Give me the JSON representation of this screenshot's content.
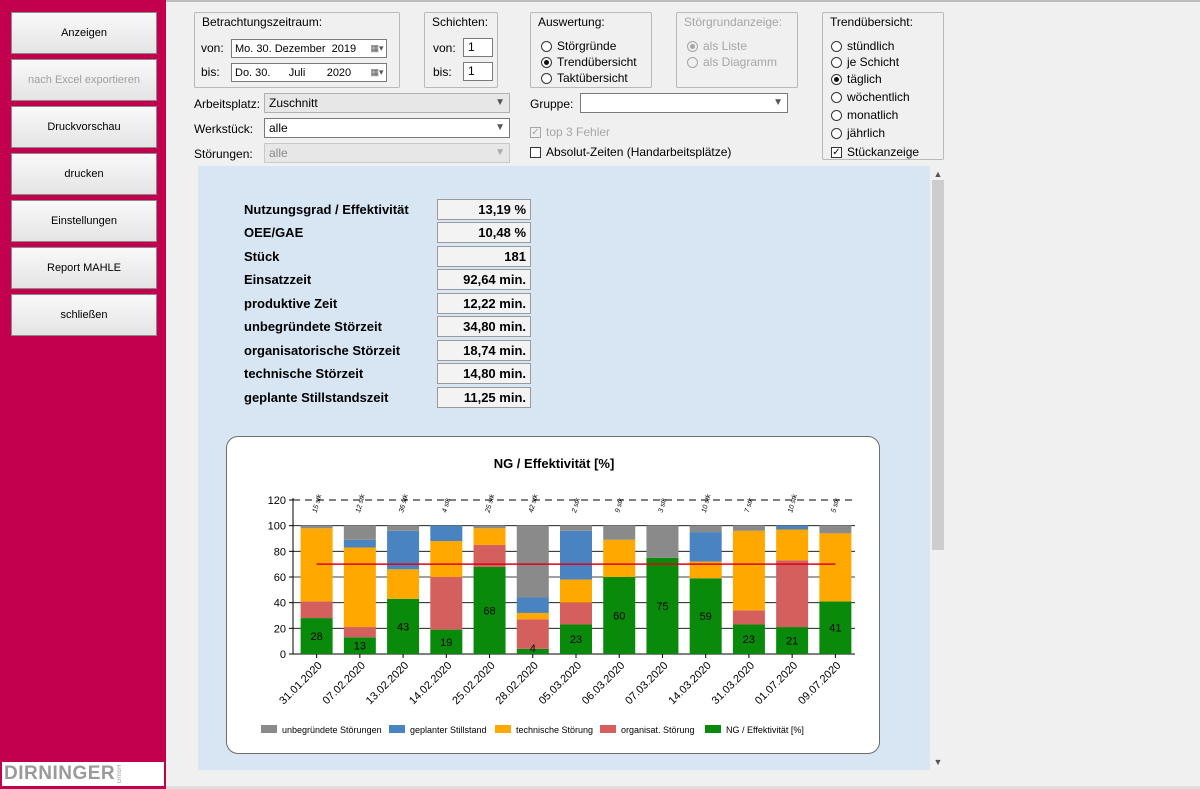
{
  "sidebar": {
    "buttons": [
      {
        "label": "Anzeigen",
        "enabled": true
      },
      {
        "label": "nach Excel exportieren",
        "enabled": false
      },
      {
        "label": "Druckvorschau",
        "enabled": true
      },
      {
        "label": "drucken",
        "enabled": true
      },
      {
        "label": "Einstellungen",
        "enabled": true
      },
      {
        "label": "Report MAHLE",
        "enabled": true
      },
      {
        "label": "schließen",
        "enabled": true
      }
    ],
    "logo": "DIRNINGER",
    "logo_tm": "GmbH",
    "accent_color": "#c2004e"
  },
  "zeitraum": {
    "title": "Betrachtungszeitraum:",
    "von_label": "von:",
    "von_value": "Mo. 30. Dezember  2019",
    "bis_label": "bis:",
    "bis_value": "Do. 30.      Juli       2020"
  },
  "schichten": {
    "title": "Schichten:",
    "von_label": "von:",
    "von_value": "1",
    "bis_label": "bis:",
    "bis_value": "1"
  },
  "auswertung": {
    "title": "Auswertung:",
    "options": [
      "Störgründe",
      "Trendübersicht",
      "Taktübersicht"
    ],
    "selected": "Trendübersicht"
  },
  "stoergrundanzeige": {
    "title": "Störgrundanzeige:",
    "options": [
      "als Liste",
      "als Diagramm"
    ],
    "selected": "als Liste"
  },
  "trenduebersicht": {
    "title": "Trendübersicht:",
    "options": [
      "stündlich",
      "je Schicht",
      "täglich",
      "wöchentlich",
      "monatlich",
      "jährlich"
    ],
    "selected": "täglich",
    "stueckanzeige_label": "Stückanzeige",
    "stueckanzeige_checked": true
  },
  "filters": {
    "arbeitsplatz_label": "Arbeitsplatz:",
    "arbeitsplatz_value": "Zuschnitt",
    "werkstueck_label": "Werkstück:",
    "werkstueck_value": "alle",
    "stoerungen_label": "Störungen:",
    "stoerungen_value": "alle",
    "gruppe_label": "Gruppe:",
    "gruppe_value": "",
    "top3_label": "top 3 Fehler",
    "top3_checked": true,
    "absolut_label": "Absolut-Zeiten (Handarbeitsplätze)",
    "absolut_checked": false
  },
  "kpis": [
    {
      "label": "Nutzungsgrad / Effektivität",
      "value": "13,19 %"
    },
    {
      "label": "OEE/GAE",
      "value": "10,48 %"
    },
    {
      "label": "Stück",
      "value": "181"
    },
    {
      "label": "Einsatzzeit",
      "value": "92,64 min."
    },
    {
      "label": "produktive Zeit",
      "value": "12,22 min."
    },
    {
      "label": "unbegründete Störzeit",
      "value": "34,80 min."
    },
    {
      "label": "organisatorische Störzeit",
      "value": "18,74 min."
    },
    {
      "label": "technische Störzeit",
      "value": "14,80 min."
    },
    {
      "label": "geplante Stillstandszeit",
      "value": "11,25 min."
    }
  ],
  "chart_data": {
    "type": "bar",
    "stacked": true,
    "title": "NG / Effektivität [%]",
    "categories": [
      "31.01.2020",
      "07.02.2020",
      "13.02.2020",
      "14.02.2020",
      "25.02.2020",
      "28.02.2020",
      "05.03.2020",
      "06.03.2020",
      "07.03.2020",
      "14.03.2020",
      "31.03.2020",
      "01.07.2020",
      "09.07.2020"
    ],
    "stueck": [
      "15 stk",
      "12 stk",
      "36 stk",
      "4 stk",
      "25 stk",
      "42 stk",
      "2 stk",
      "9 stk",
      "3 stk",
      "10 stk",
      "7 stk",
      "10 stk",
      "5 stk"
    ],
    "series": [
      {
        "name": "NG / Effektivität [%]",
        "color": "#0a8a0a",
        "values": [
          28,
          13,
          43,
          19,
          68,
          4,
          23,
          60,
          75,
          59,
          23,
          21,
          41
        ]
      },
      {
        "name": "organisat. Störung",
        "color": "#d4605e",
        "values": [
          13,
          8,
          0,
          41,
          17,
          23,
          17,
          0,
          0,
          0,
          11,
          52,
          0
        ]
      },
      {
        "name": "technische Störung",
        "color": "#ffa800",
        "values": [
          57,
          62,
          23,
          28,
          13,
          5,
          18,
          29,
          0,
          13,
          62,
          24,
          53
        ]
      },
      {
        "name": "geplanter Stillstand",
        "color": "#4a84c0",
        "values": [
          0,
          6,
          30,
          12,
          0,
          12,
          38,
          0,
          0,
          23,
          0,
          3,
          0
        ]
      },
      {
        "name": "unbegründete Störungen",
        "color": "#8a8a8a",
        "values": [
          2,
          11,
          4,
          0,
          2,
          56,
          4,
          11,
          25,
          5,
          4,
          0,
          6
        ]
      }
    ],
    "legend_order": [
      "unbegründete Störungen",
      "geplanter Stillstand",
      "technische Störung",
      "organisat. Störung",
      "NG / Effektivität [%]"
    ],
    "target_line": 70,
    "target_line_color": "#e0001a",
    "ylim": [
      0,
      120
    ],
    "yticks": [
      0,
      20,
      40,
      60,
      80,
      100,
      120
    ],
    "legend_position": "bottom"
  }
}
